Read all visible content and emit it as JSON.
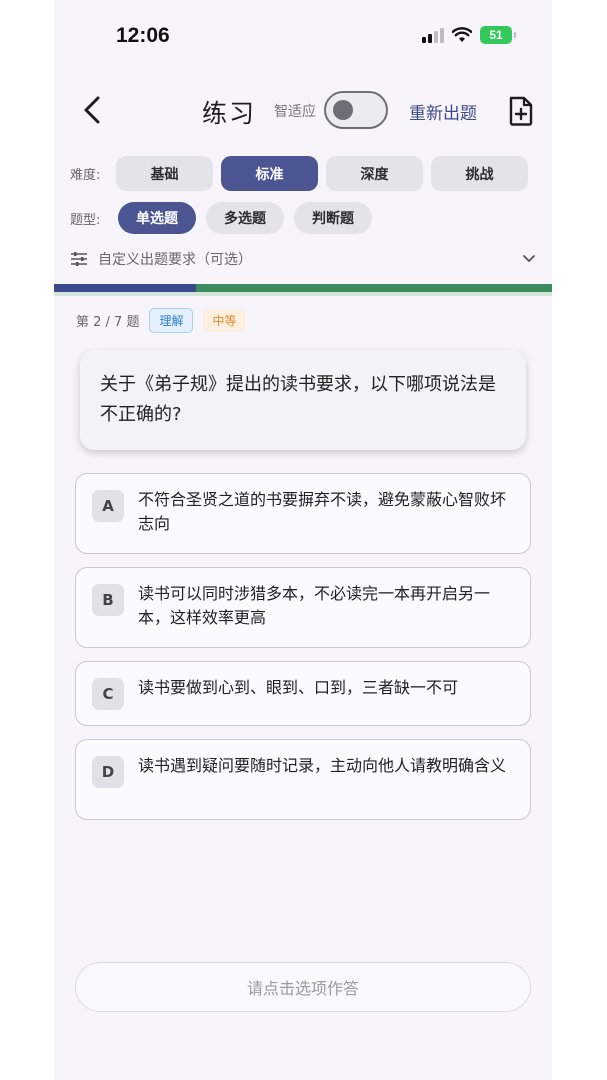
{
  "status": {
    "time": "12:06",
    "battery": "51"
  },
  "header": {
    "title": "练习",
    "toggle_label": "智适应",
    "toggle_on": false,
    "regen_label": "重新出题"
  },
  "difficulty": {
    "label": "难度:",
    "options": [
      "基础",
      "标准",
      "深度",
      "挑战"
    ],
    "selected": "标准"
  },
  "qtype": {
    "label": "题型:",
    "options": [
      "单选题",
      "多选题",
      "判断题"
    ],
    "selected": "单选题"
  },
  "custom": {
    "text": "自定义出题要求（可选）"
  },
  "progress": {
    "current": 2,
    "total": 7,
    "fraction": 0.2857
  },
  "meta": {
    "count_text": "第 2 / 7 题",
    "skill_tag": "理解",
    "level_tag": "中等"
  },
  "question": {
    "text": "关于《弟子规》提出的读书要求，以下哪项说法是不正确的?"
  },
  "options": [
    {
      "letter": "A",
      "text": "不符合圣贤之道的书要摒弃不读，避免蒙蔽心智败坏志向"
    },
    {
      "letter": "B",
      "text": "读书可以同时涉猎多本，不必读完一本再开启另一本，这样效率更高"
    },
    {
      "letter": "C",
      "text": "读书要做到心到、眼到、口到，三者缺一不可"
    },
    {
      "letter": "D",
      "text": "读书遇到疑问要随时记录，主动向他人请教明确含义"
    }
  ],
  "answer_button": {
    "label": "请点击选项作答"
  },
  "colors": {
    "accent": "#4b5591",
    "progress": "#3e8c5e",
    "link": "#3d4a8a"
  }
}
